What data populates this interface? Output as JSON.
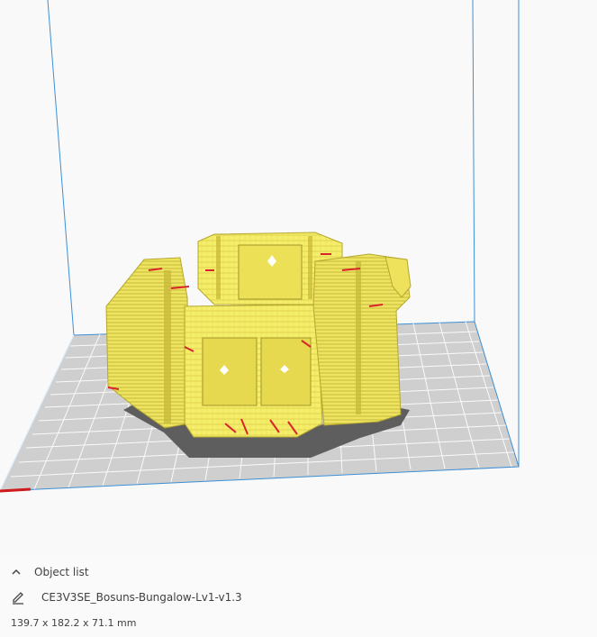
{
  "viewport": {
    "description_colors": {
      "background": "#f9f9f9",
      "build_volume_edge": "#3c8fd6",
      "build_plate": "#c9c9c9",
      "grid_lines": "#ffffff",
      "model_fill": "#f5ee6a",
      "model_shade": "#c8b93a",
      "overhang_red": "#d9242b",
      "shadow": "#5e5e5e",
      "x_axis": "#d11a1a"
    }
  },
  "object_panel": {
    "toggle_label": "Object list",
    "toggle_icon": "chevron-up-icon",
    "edit_icon": "pencil-icon",
    "file_name": "CE3V3SE_Bosuns-Bungalow-Lv1-v1.3",
    "dimensions": "139.7 x 182.2 x 71.1 mm"
  }
}
